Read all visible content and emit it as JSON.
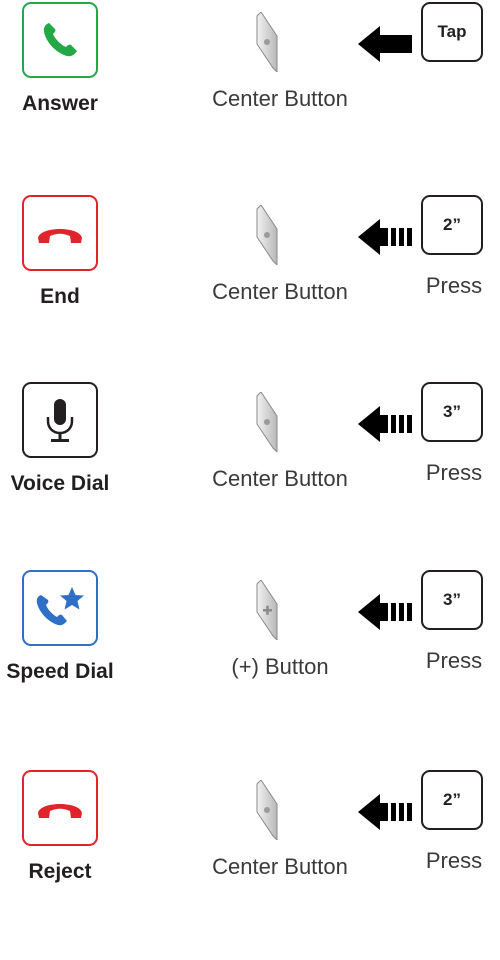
{
  "rows": [
    {
      "label": "Answer",
      "icon": "phone-answer-icon",
      "icon_color": "#22a845",
      "button": "Center Button",
      "action": "Tap",
      "action_note": ""
    },
    {
      "label": "End",
      "icon": "phone-hangup-icon",
      "icon_color": "#e0242a",
      "button": "Center Button",
      "action": "2”",
      "action_note": "Press"
    },
    {
      "label": "Voice Dial",
      "icon": "microphone-icon",
      "icon_color": "#231f20",
      "button": "Center Button",
      "action": "3”",
      "action_note": "Press"
    },
    {
      "label": "Speed Dial",
      "icon": "phone-star-icon",
      "icon_color": "#2f6fc6",
      "button": "(+) Button",
      "action": "3”",
      "action_note": "Press"
    },
    {
      "label": "Reject",
      "icon": "phone-hangup-icon",
      "icon_color": "#e0242a",
      "button": "Center Button",
      "action": "2”",
      "action_note": "Press"
    }
  ]
}
